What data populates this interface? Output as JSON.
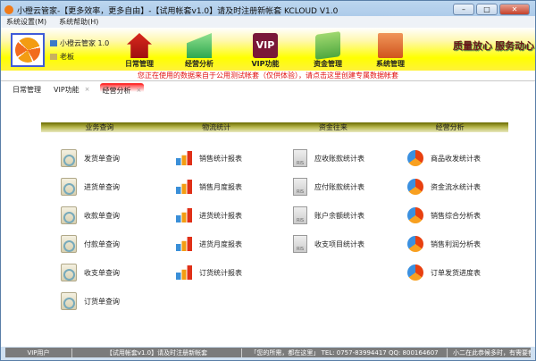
{
  "window": {
    "title": "小橙云管家-【更多效率，更多自由】-【试用帐套v1.0】请及时注册新帐套  KCLOUD V1.0",
    "minimize": "–",
    "maximize": "□",
    "close": "✕"
  },
  "menu": [
    "系统设置(M)",
    "系统帮助(H)"
  ],
  "user": {
    "app": "小橙云管家 1.0",
    "name": "老板"
  },
  "toolbar": [
    "日常管理",
    "经营分析",
    "VIP功能",
    "资金管理",
    "系统管理"
  ],
  "vip_icon_text": "VIP",
  "slogans": [
    "质量放心",
    "服务动心"
  ],
  "notice": "您正在使用的数据来自于公用测试帐套（仅供体验），请点击这里创建专属数据帐套",
  "tabs": [
    {
      "label": "日常管理"
    },
    {
      "label": "VIP功能",
      "close": "×"
    },
    {
      "label": "经营分析",
      "close": "×"
    }
  ],
  "sections": [
    {
      "title": "业务查询",
      "items": [
        "发货单查询",
        "进货单查询",
        "收款单查询",
        "付款单查询",
        "收支单查询",
        "订货单查询"
      ]
    },
    {
      "title": "物流统计",
      "items": [
        "销售统计报表",
        "销售月度报表",
        "进货统计报表",
        "进货月度报表",
        "订货统计报表"
      ]
    },
    {
      "title": "资金往来",
      "items": [
        "应收账款统计表",
        "应付账款统计表",
        "账户余额统计表",
        "收支项目统计表"
      ]
    },
    {
      "title": "经营分析",
      "items": [
        "商品收发统计表",
        "资金流水统计表",
        "销售综合分析表",
        "销售利润分析表",
        "订单发货进度表"
      ]
    }
  ],
  "ris_text": "RIS",
  "status": [
    "VIP用户",
    "【试用帐套v1.0】请及时注册新帐套",
    "「您的所需，都在这里」 TEL: 0757-83994417  QQ: 800164607",
    "小二在此恭候多时，有需要都"
  ]
}
